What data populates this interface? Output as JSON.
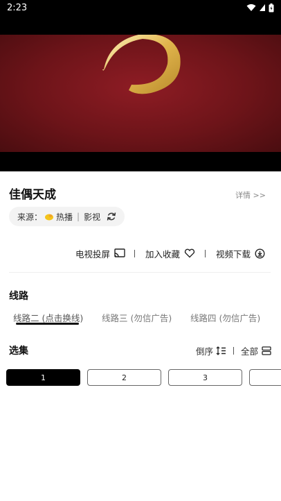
{
  "status_bar": {
    "time": "2:23"
  },
  "header": {
    "title": "佳偶天成",
    "detail_link": "详情 >>"
  },
  "source": {
    "label": "来源：",
    "name": "热播",
    "category": "影视"
  },
  "actions": {
    "cast": "电视投屏",
    "favorite": "加入收藏",
    "download": "视频下载"
  },
  "routes": {
    "title": "线路",
    "items": [
      {
        "label": "线路二 (点击换线)"
      },
      {
        "label": "线路三 (勿信广告)"
      },
      {
        "label": "线路四 (勿信广告)"
      }
    ]
  },
  "episodes": {
    "title": "选集",
    "order_label": "倒序",
    "all_label": "全部",
    "items": [
      "1",
      "2",
      "3"
    ]
  }
}
